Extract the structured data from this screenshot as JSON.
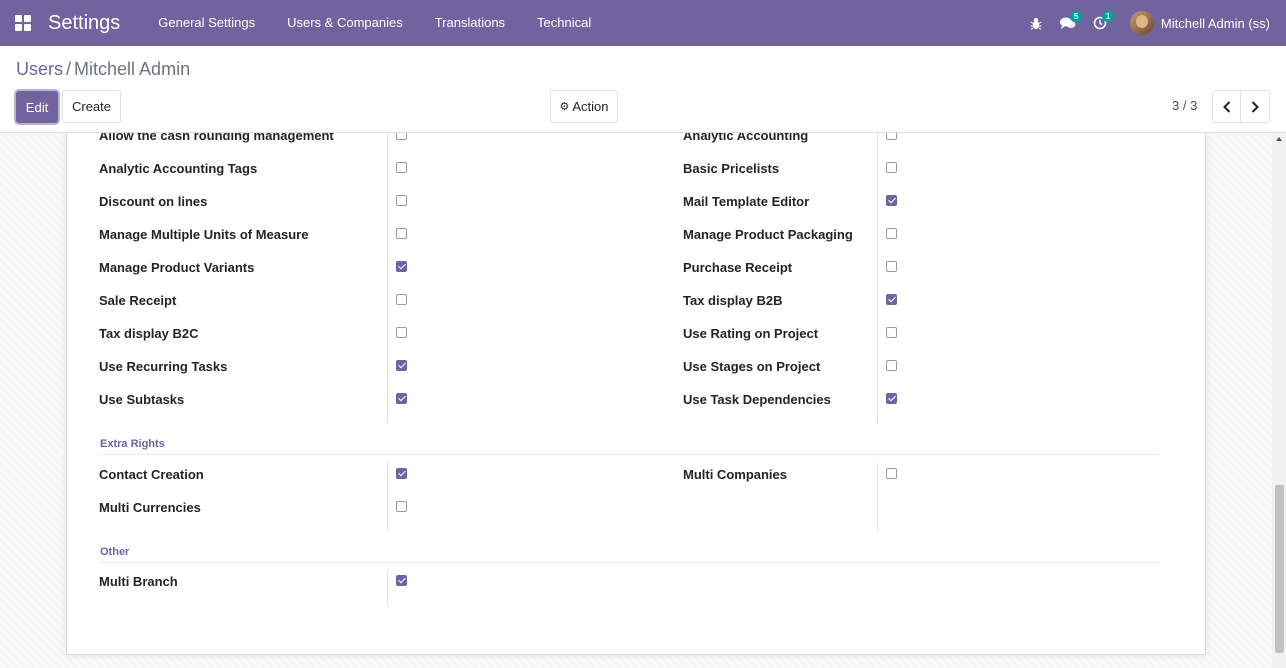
{
  "navbar": {
    "brand": "Settings",
    "menu": [
      "General Settings",
      "Users & Companies",
      "Translations",
      "Technical"
    ],
    "chat_badge": "5",
    "activity_badge": "1",
    "user_name": "Mitchell Admin (ss)",
    "bg_color": "#71639e"
  },
  "breadcrumb": {
    "parent": "Users",
    "separator": "/",
    "current": "Mitchell Admin"
  },
  "buttons": {
    "edit": "Edit",
    "create": "Create",
    "action": "Action"
  },
  "pager": {
    "value": "3 / 3"
  },
  "groups": {
    "main_left": [
      {
        "label": "Allow the cash rounding management",
        "checked": false
      },
      {
        "label": "Analytic Accounting Tags",
        "checked": false
      },
      {
        "label": "Discount on lines",
        "checked": false
      },
      {
        "label": "Manage Multiple Units of Measure",
        "checked": false
      },
      {
        "label": "Manage Product Variants",
        "checked": true
      },
      {
        "label": "Sale Receipt",
        "checked": false
      },
      {
        "label": "Tax display B2C",
        "checked": false
      },
      {
        "label": "Use Recurring Tasks",
        "checked": true
      },
      {
        "label": "Use Subtasks",
        "checked": true
      }
    ],
    "main_right": [
      {
        "label": "Analytic Accounting",
        "checked": false
      },
      {
        "label": "Basic Pricelists",
        "checked": false
      },
      {
        "label": "Mail Template Editor",
        "checked": true
      },
      {
        "label": "Manage Product Packaging",
        "checked": false
      },
      {
        "label": "Purchase Receipt",
        "checked": false
      },
      {
        "label": "Tax display B2B",
        "checked": true
      },
      {
        "label": "Use Rating on Project",
        "checked": false
      },
      {
        "label": "Use Stages on Project",
        "checked": false
      },
      {
        "label": "Use Task Dependencies",
        "checked": true
      }
    ],
    "extra_rights_title": "Extra Rights",
    "extra_left": [
      {
        "label": "Contact Creation",
        "checked": true
      },
      {
        "label": "Multi Currencies",
        "checked": false
      }
    ],
    "extra_right": [
      {
        "label": "Multi Companies",
        "checked": false
      }
    ],
    "other_title": "Other",
    "other_left": [
      {
        "label": "Multi Branch",
        "checked": true
      }
    ]
  }
}
